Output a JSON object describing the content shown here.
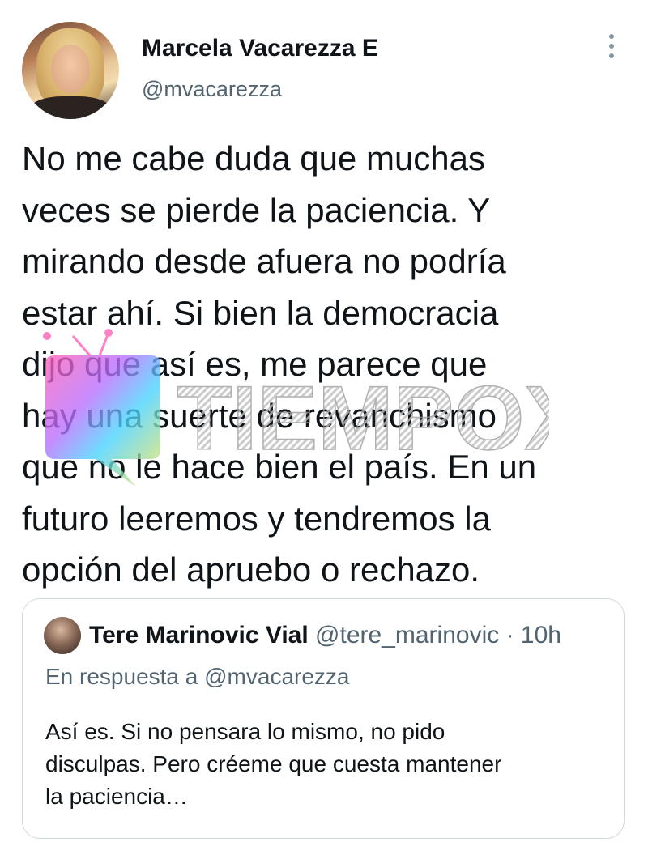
{
  "author": {
    "name": "Marcela Vacarezza E",
    "handle": "@mvacarezza"
  },
  "tweet": {
    "lines": [
      "No me cabe duda que muchas",
      "veces se pierde la paciencia. Y",
      "mirando desde afuera no podría",
      "estar ahí. Si bien la democracia",
      "dijo que así es, me parece que",
      "hay una suerte de revanchismo",
      "que no le hace bien el país. En un",
      "futuro leeremos y tendremos la",
      "opción del apruebo o rechazo."
    ]
  },
  "watermark": {
    "text": "TIEMPOX"
  },
  "quoted": {
    "name": "Tere Marinovic Vial",
    "handle": "@tere_marinovic",
    "separator": "·",
    "time": "10h",
    "reply_to": "En respuesta a @mvacarezza",
    "lines": [
      "Así es. Si no pensara lo mismo, no pido",
      "disculpas. Pero créeme que cuesta mantener",
      "la paciencia…"
    ]
  },
  "icons": {
    "more": "more-vertical-icon"
  },
  "colors": {
    "text": "#0f1419",
    "secondary": "#536471",
    "border": "#cfd9de"
  }
}
